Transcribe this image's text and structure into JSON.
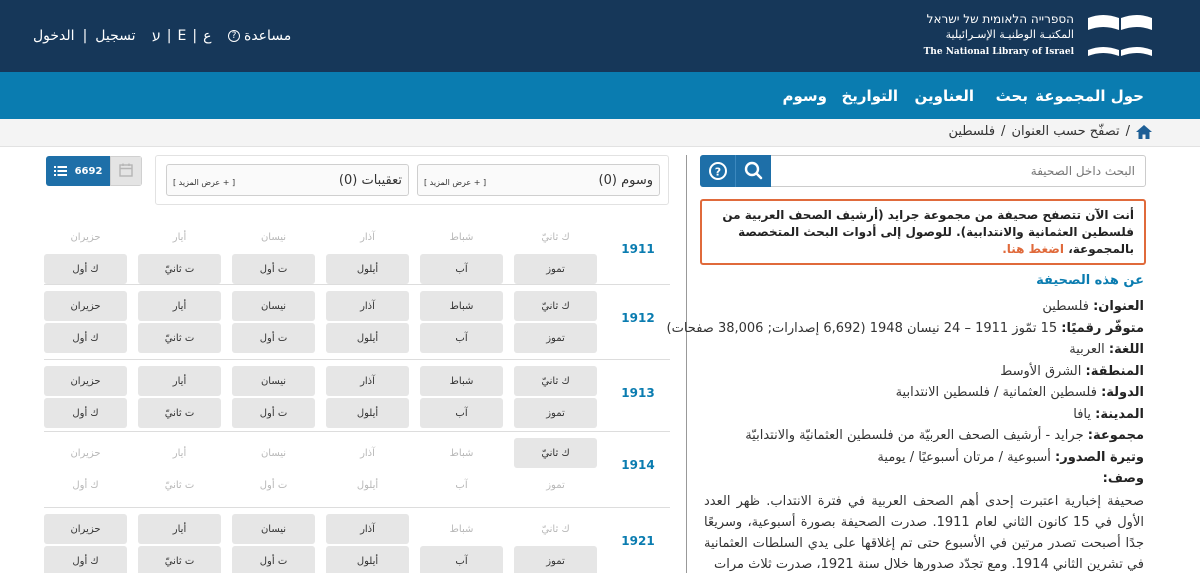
{
  "header": {
    "logo_hebrew": "הספרייה הלאומית של ישראל",
    "logo_arabic": "المكتبـة الوطنيـة الإسـرائيلية",
    "logo_english": "The National Library of Israel",
    "help_label": "مساعدة",
    "help_icon": "question-circle-icon",
    "lang_he": "ע",
    "lang_en": "E",
    "lang_ar": "ع",
    "register_label": "تسجيل",
    "separator": "|",
    "login_label": "الدخول"
  },
  "nav": {
    "items": [
      "حول المجموعة",
      "بحث",
      "العناوين",
      "التواريخ",
      "وسوم"
    ]
  },
  "breadcrumb": {
    "home_icon": "home-icon",
    "separator": "/",
    "items": [
      "تصفّح حسب العنوان",
      "فلسطين"
    ]
  },
  "search": {
    "placeholder": "البحث داخل الصحيفة",
    "search_icon": "search-icon",
    "help_icon": "question-circle-icon"
  },
  "notice": {
    "text": "أنت الآن تتصفح صحيفة من مجموعة جرايد (أرشيف الصحف العربية من فلسطين العثمانية والانتدابية). للوصول إلى أدوات البحث المتخصصة بالمجموعة،",
    "link_text": "اضغط هنا."
  },
  "about": {
    "title": "عن هذه الصحيفة",
    "details": [
      {
        "label": "العنوان:",
        "value": "فلسطين"
      },
      {
        "label": "متوفّر رقميًا:",
        "value": "15 تمّوز 1911 – 24 نيسان 1948 (6,692 إصدارات; 38,006 صفحات)"
      },
      {
        "label": "اللغة:",
        "value": "العربية"
      },
      {
        "label": "المنطقة:",
        "value": "الشرق الأوسط"
      },
      {
        "label": "الدولة:",
        "value": "فلسطين العثمانية / فلسطين الانتدابية"
      },
      {
        "label": "المدينة:",
        "value": "يافا"
      },
      {
        "label": "مجموعة:",
        "value": "جرايد - أرشيف الصحف العربيّة من فلسطين العثمانيّة والانتدابيّة"
      },
      {
        "label": "وتيرة الصدور:",
        "value": "أسبوعية / مرتان أسبوعيًا / يومية"
      }
    ],
    "description_label": "وصف:",
    "description": "صحيفة إخبارية اعتبرت إحدى أهم الصحف العربية في فترة الانتداب. ظهر العدد الأول في 15 كانون الثاني لعام 1911. صدرت الصحيفة بصورة أسبوعية، وسريعًا جدًا أصبحت تصدر مرتين في الأسبوع حتى تم إغلاقها على يدي السلطات العثمانية في تشرين الثاني 1914. ومع تجدّد صدورها خلال سنة 1921، صدرت ثلاث مرات"
  },
  "toolbar": {
    "issue_count": "6692",
    "list_icon": "list-icon",
    "calendar_icon": "calendar-icon"
  },
  "filters": [
    {
      "title": "وسوم (0)",
      "more": "[ + عرض المزيد ]"
    },
    {
      "title": "تعقيبات (0)",
      "more": "[ + عرض المزيد ]"
    }
  ],
  "month_names": {
    "row1": [
      "ك ثانيّ",
      "شباط",
      "آذار",
      "نيسان",
      "أيار",
      "حزيران"
    ],
    "row2": [
      "تموز",
      "آب",
      "أيلول",
      "ت أول",
      "ت ثانيّ",
      "ك أول"
    ]
  },
  "years": [
    {
      "year": "1911",
      "row1_active": [
        false,
        false,
        false,
        false,
        false,
        false
      ],
      "row2_active": [
        true,
        true,
        true,
        true,
        true,
        true
      ]
    },
    {
      "year": "1912",
      "row1_active": [
        true,
        true,
        true,
        true,
        true,
        true
      ],
      "row2_active": [
        true,
        true,
        true,
        true,
        true,
        true
      ]
    },
    {
      "year": "1913",
      "row1_active": [
        true,
        true,
        true,
        true,
        true,
        true
      ],
      "row2_active": [
        true,
        true,
        true,
        true,
        true,
        true
      ]
    },
    {
      "year": "1914",
      "row1_active": [
        true,
        false,
        false,
        false,
        false,
        false
      ],
      "row2_active": [
        false,
        false,
        false,
        false,
        false,
        false
      ]
    },
    {
      "year": "1921",
      "row1_active": [
        false,
        false,
        true,
        true,
        true,
        true
      ],
      "row2_active": [
        true,
        true,
        true,
        true,
        true,
        true
      ]
    }
  ]
}
